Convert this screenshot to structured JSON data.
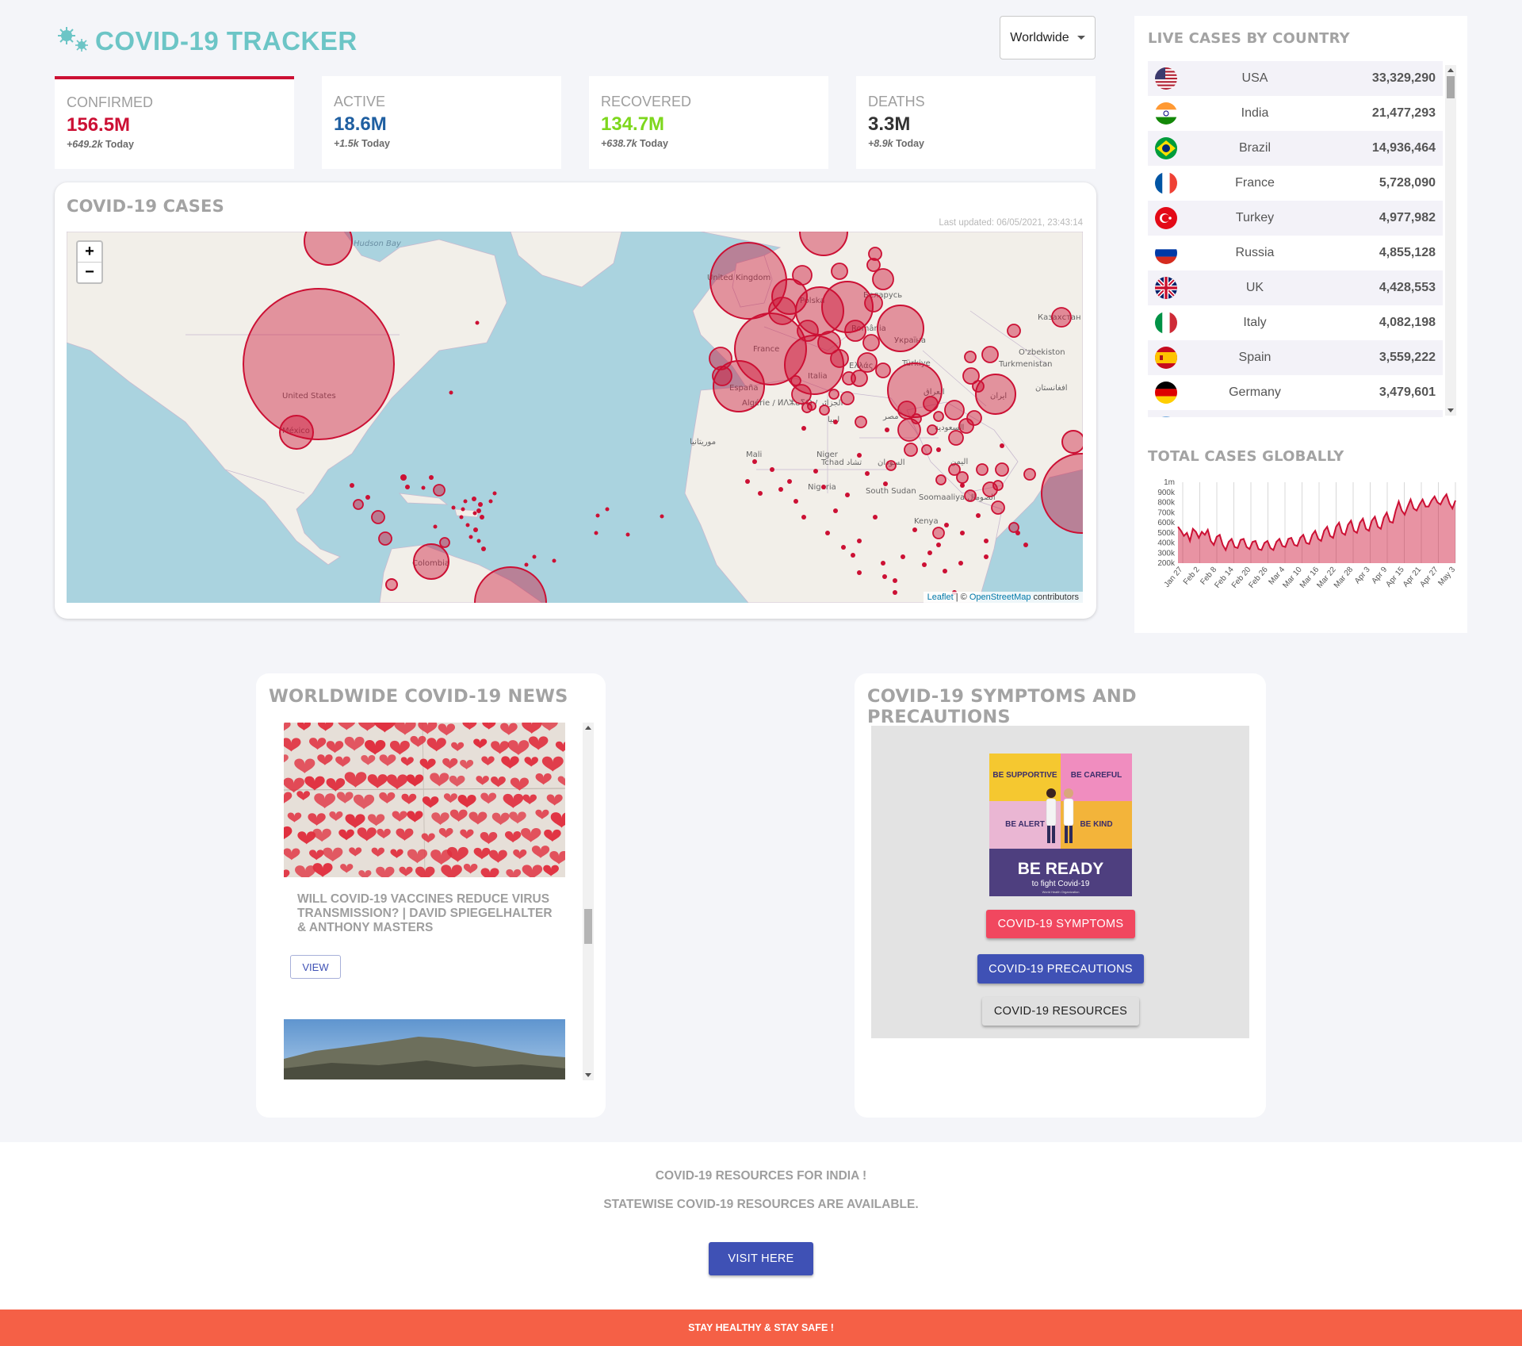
{
  "header": {
    "title": "COVID-19 TRACKER",
    "country_select": "Worldwide"
  },
  "stats": [
    {
      "label": "Confirmed",
      "value": "156.5M",
      "today": "+649.2k",
      "today_suffix": "Today",
      "color": "#cc1034"
    },
    {
      "label": "Active",
      "value": "18.6M",
      "today": "+1.5k",
      "today_suffix": "Today",
      "color": "#1f5fa1"
    },
    {
      "label": "Recovered",
      "value": "134.7M",
      "today": "+638.7k",
      "today_suffix": "Today",
      "color": "#7dd71d"
    },
    {
      "label": "Deaths",
      "value": "3.3M",
      "today": "+8.9k",
      "today_suffix": "Today",
      "color": "#333333"
    }
  ],
  "map": {
    "title": "COVID-19 CASES",
    "last_updated": "Last updated: 06/05/2021, 23:43:14",
    "zoom_in": "+",
    "zoom_out": "−",
    "attribution_leaflet": "Leaflet",
    "attribution_sep": " | © ",
    "attribution_osm": "OpenStreetMap",
    "attribution_rest": " contributors",
    "labels": [
      "Hudson Bay",
      "United States",
      "México",
      "Colombia",
      "United Kingdom",
      "France",
      "España",
      "Italia",
      "Беларусь",
      "Україна",
      "Türkiye",
      "Казахстан",
      "O'zbekiston",
      "Turkmenistan",
      "ایران",
      "العراق",
      "افغانستان",
      "Algérie / ⵍⴷⵣⴰⵢⵔ / الجزائر",
      "موريتانيا",
      "Mali",
      "Niger",
      "Tchad تشاد",
      "السودان",
      "Nigeria",
      "South Sudan",
      "Soomaaliya الصومال",
      "Kenya",
      "ليبيا",
      "مصر",
      "السعودية",
      "اليمن",
      "Ελλάς",
      "România",
      "Polska"
    ]
  },
  "live_cases": {
    "title": "LIVE CASES BY COUNTRY",
    "rows": [
      {
        "country": "USA",
        "cases": "33,329,290",
        "flag": "us"
      },
      {
        "country": "India",
        "cases": "21,477,293",
        "flag": "in"
      },
      {
        "country": "Brazil",
        "cases": "14,936,464",
        "flag": "br"
      },
      {
        "country": "France",
        "cases": "5,728,090",
        "flag": "fr"
      },
      {
        "country": "Turkey",
        "cases": "4,977,982",
        "flag": "tr"
      },
      {
        "country": "Russia",
        "cases": "4,855,128",
        "flag": "ru"
      },
      {
        "country": "UK",
        "cases": "4,428,553",
        "flag": "gb"
      },
      {
        "country": "Italy",
        "cases": "4,082,198",
        "flag": "it"
      },
      {
        "country": "Spain",
        "cases": "3,559,222",
        "flag": "es"
      },
      {
        "country": "Germany",
        "cases": "3,479,601",
        "flag": "de"
      }
    ]
  },
  "total_cases": {
    "title": "TOTAL CASES GLOBALLY"
  },
  "chart_data": {
    "type": "area",
    "title": "TOTAL CASES GLOBALLY",
    "xlabel": "",
    "ylabel": "",
    "x_ticks": [
      "Jan 27",
      "Feb 2",
      "Feb 8",
      "Feb 14",
      "Feb 20",
      "Feb 26",
      "Mar 4",
      "Mar 10",
      "Mar 16",
      "Mar 22",
      "Mar 28",
      "Apr 3",
      "Apr 9",
      "Apr 15",
      "Apr 21",
      "Apr 27",
      "May 3"
    ],
    "y_ticks": [
      "200k",
      "300k",
      "400k",
      "500k",
      "600k",
      "700k",
      "800k",
      "900k",
      "1m"
    ],
    "ylim": [
      200000,
      1000000
    ],
    "color": "#cc1034",
    "series": [
      {
        "values": [
          560000,
          520000,
          470000,
          500000,
          420000,
          540000,
          510000,
          450000,
          510000,
          480000,
          530000,
          420000,
          380000,
          460000,
          480000,
          380000,
          330000,
          410000,
          440000,
          360000,
          350000,
          430000,
          440000,
          360000,
          340000,
          410000,
          420000,
          340000,
          330000,
          400000,
          420000,
          350000,
          330000,
          410000,
          440000,
          370000,
          360000,
          440000,
          450000,
          380000,
          370000,
          450000,
          480000,
          400000,
          390000,
          480000,
          520000,
          440000,
          420000,
          520000,
          560000,
          470000,
          450000,
          560000,
          600000,
          500000,
          480000,
          580000,
          620000,
          520000,
          500000,
          600000,
          640000,
          540000,
          520000,
          620000,
          660000,
          560000,
          540000,
          650000,
          700000,
          610000,
          600000,
          720000,
          810000,
          720000,
          680000,
          760000,
          830000,
          740000,
          720000,
          780000,
          830000,
          760000,
          760000,
          820000,
          860000,
          800000,
          780000,
          840000,
          880000,
          790000,
          740000,
          820000
        ]
      }
    ]
  },
  "news": {
    "title": "WORLDWIDE COVID-19 NEWS",
    "headline": "Will Covid-19 vaccines reduce virus transmission? | David Spiegelhalter & Anthony Masters",
    "view_label": "VIEW"
  },
  "symptoms": {
    "title": "COVID-19 SYMPTOMS AND PRECAUTIONS",
    "poster": {
      "q1": "BE SUPPORTIVE",
      "q2": "BE CAREFUL",
      "q3": "BE ALERT",
      "q4": "BE KIND",
      "big": "BE READY",
      "sub": "to fight Covid-19",
      "org": "World Health Organization"
    },
    "btn_symptoms": "COVID-19 SYMPTOMS",
    "btn_precautions": "COVID-19 PRECAUTIONS",
    "btn_resources": "COVID-19 RESOURCES"
  },
  "india": {
    "line1": "COVID-19 RESOURCES FOR INDIA !",
    "line2": "STATEWISE COVID-19 RESOURCES ARE AVAILABLE.",
    "button": "VISIT HERE"
  },
  "footer": {
    "text": "STAY HEALTHY & STAY SAFE !"
  }
}
